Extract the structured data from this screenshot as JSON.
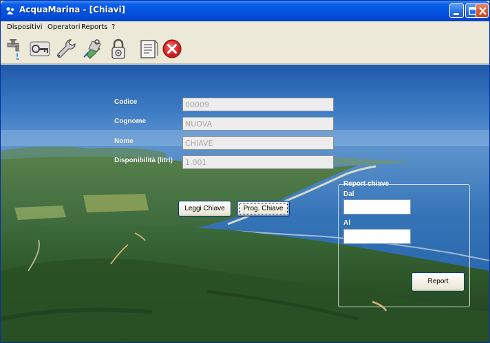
{
  "window": {
    "title": "AcquaMarina - [Chiavi]"
  },
  "menu": {
    "items": [
      {
        "label": "Dispositivi"
      },
      {
        "label": "Operatori"
      },
      {
        "label": "Reports"
      },
      {
        "label": "?"
      }
    ]
  },
  "toolbar": {
    "tools": [
      {
        "icon": "water-tap-icon"
      },
      {
        "icon": "key-icon"
      },
      {
        "icon": "wrench-icon"
      },
      {
        "icon": "key-card-program-icon"
      },
      {
        "icon": "padlock-icon"
      },
      {
        "icon": "report-sheet-icon"
      },
      {
        "icon": "exit-icon"
      }
    ]
  },
  "form": {
    "codice_label": "Codice",
    "codice_value": "00009",
    "cognome_label": "Cognome",
    "cognome_value": "NUOVA",
    "nome_label": "Nome",
    "nome_value": "CHIAVE",
    "disponibilita_label": "Disponibilità (litri)",
    "disponibilita_value": "1.001",
    "leggi_button": "Leggi Chiave",
    "prog_button": "Prog. Chiave"
  },
  "report": {
    "group_title": "Report chiave",
    "dal_label": "Dal",
    "dal_value": "",
    "al_label": "Al",
    "al_value": "",
    "report_button": "Report"
  },
  "colors": {
    "title_bar": "#0553e0",
    "window_face": "#ece9d8",
    "sea": "#2f73b8",
    "forest": "#2f5a2c"
  }
}
